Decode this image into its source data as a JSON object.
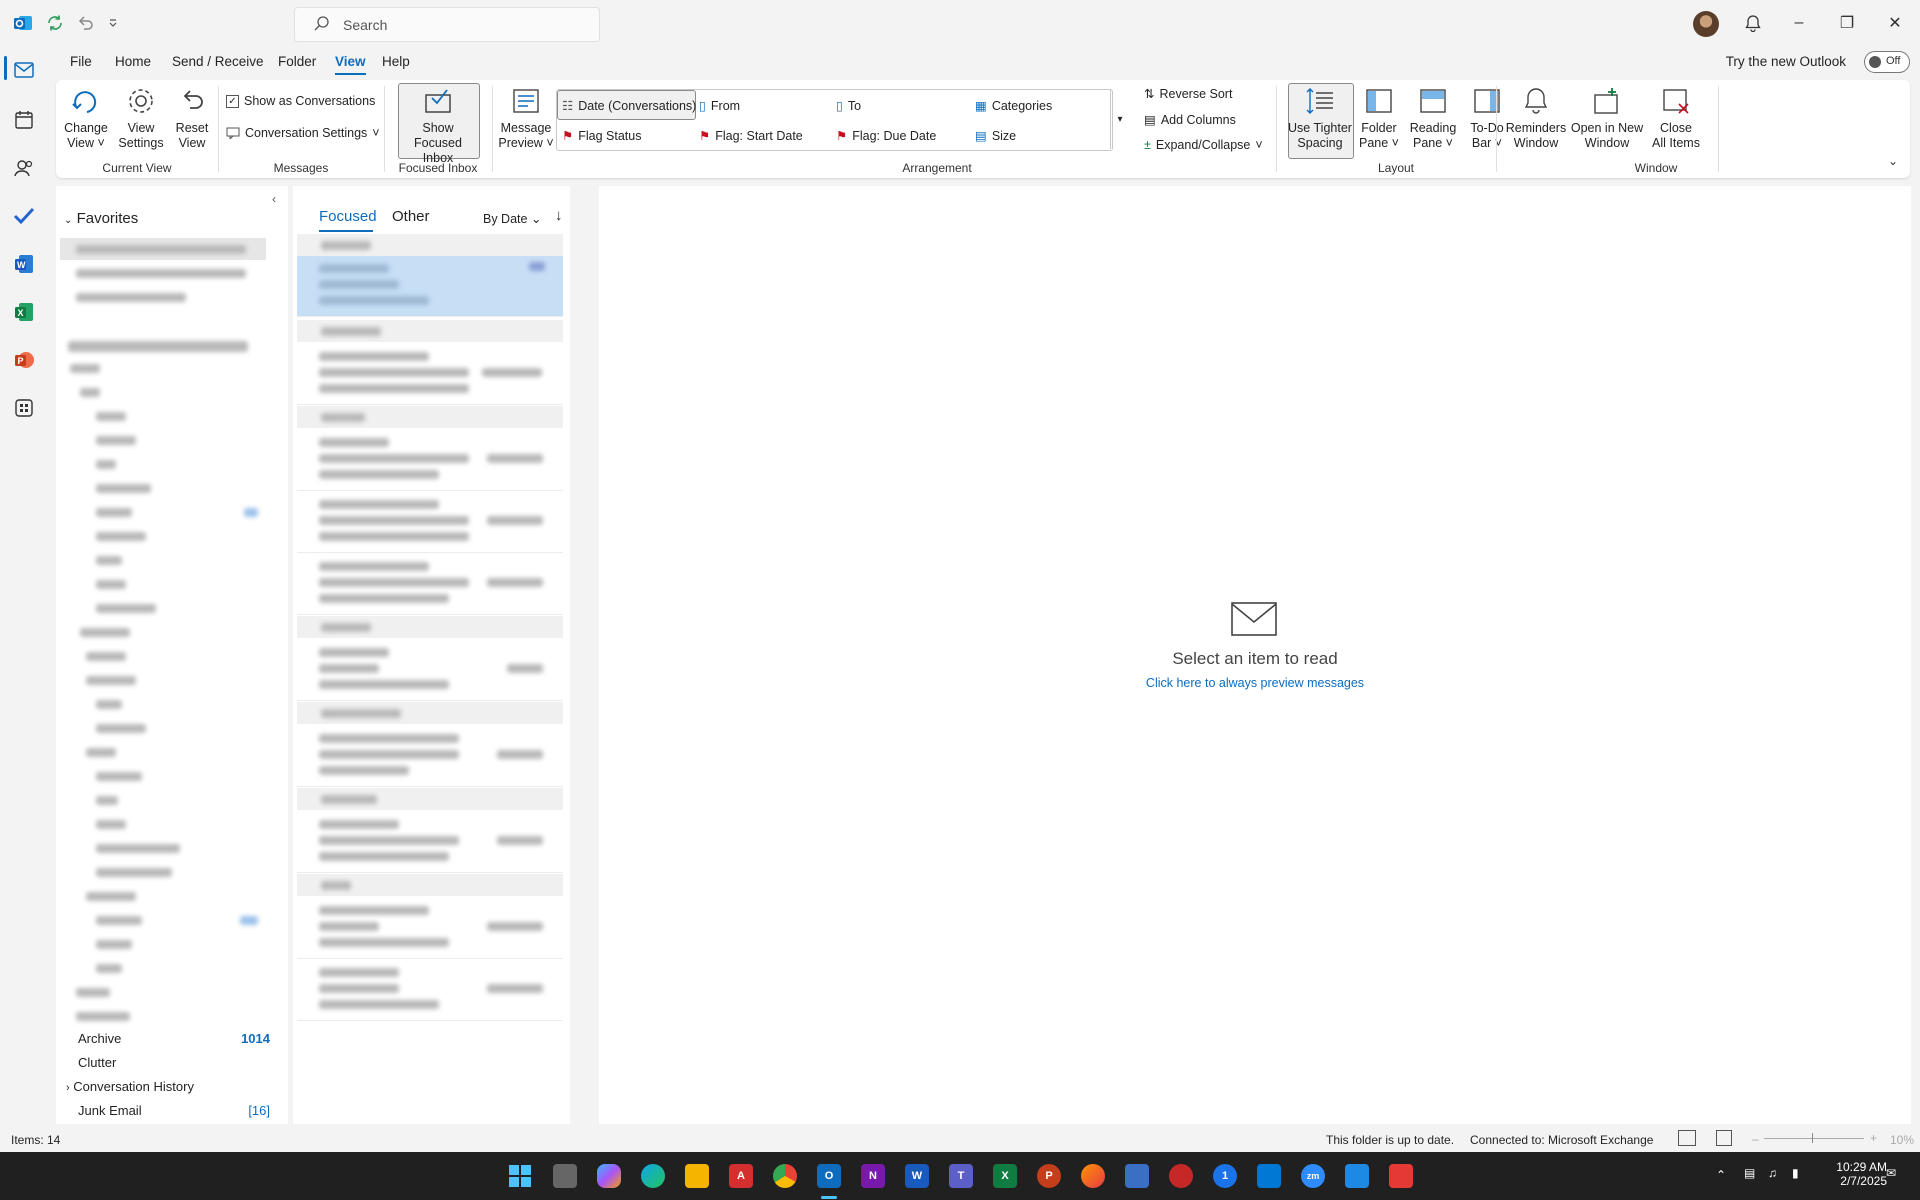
{
  "titlebar": {
    "search_placeholder": "Search"
  },
  "menu": {
    "items": [
      "File",
      "Home",
      "Send / Receive",
      "Folder",
      "View",
      "Help"
    ],
    "try_new": "Try the new Outlook",
    "toggle": "Off"
  },
  "ribbon": {
    "change_view": [
      "Change",
      "View"
    ],
    "view_settings": [
      "View",
      "Settings"
    ],
    "reset_view": [
      "Reset",
      "View"
    ],
    "current_view_group": "Current View",
    "show_conversations": "Show as Conversations",
    "conversation_settings": "Conversation Settings",
    "messages_group": "Messages",
    "show_focused": [
      "Show",
      "Focused Inbox"
    ],
    "focused_group": "Focused Inbox",
    "message_preview": [
      "Message",
      "Preview"
    ],
    "arrange": [
      "Date (Conversations)",
      "From",
      "To",
      "Categories",
      "Flag Status",
      "Flag: Start Date",
      "Flag: Due Date",
      "Size"
    ],
    "reverse_sort": "Reverse Sort",
    "add_columns": "Add Columns",
    "expand_collapse": "Expand/Collapse",
    "arrangement_group": "Arrangement",
    "tighter": [
      "Use Tighter",
      "Spacing"
    ],
    "folder_pane": [
      "Folder",
      "Pane"
    ],
    "reading_pane": [
      "Reading",
      "Pane"
    ],
    "todo": [
      "To-Do",
      "Bar"
    ],
    "layout_group": "Layout",
    "reminders": [
      "Reminders",
      "Window"
    ],
    "open_new": [
      "Open in New",
      "Window"
    ],
    "close_all": [
      "Close",
      "All Items"
    ],
    "window_group": "Window"
  },
  "folders": {
    "favorites": "Favorites",
    "visible": [
      {
        "label": "Archive",
        "count": "1014"
      },
      {
        "label": "Clutter",
        "count": ""
      },
      {
        "label": "Conversation History",
        "count": ""
      },
      {
        "label": "Junk Email",
        "count": "[16]"
      }
    ]
  },
  "list": {
    "tab_focused": "Focused",
    "tab_other": "Other",
    "sort": "By Date"
  },
  "reading": {
    "empty_title": "Select an item to read",
    "preview_link": "Click here to always preview messages"
  },
  "status": {
    "items": "Items: 14",
    "up_to_date": "This folder is up to date.",
    "connected": "Connected to: Microsoft Exchange",
    "zoom": "10%"
  },
  "taskbar": {
    "time": "10:29 AM",
    "date": "2/7/2025"
  },
  "colors": {
    "accent": "#0f6cbd",
    "selected_row": "#c7dff5"
  }
}
